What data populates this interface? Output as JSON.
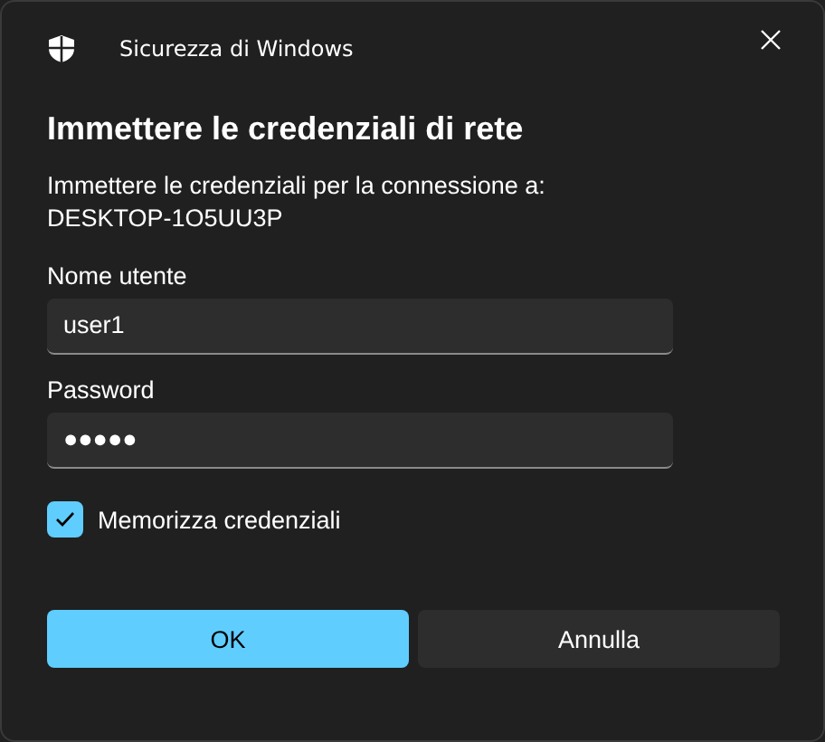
{
  "window": {
    "title": "Sicurezza di Windows"
  },
  "heading": "Immettere le credenziali di rete",
  "description": [
    "Immettere le credenziali per la connessione a:",
    "DESKTOP-1O5UU3P"
  ],
  "fields": [
    {
      "label": "Nome utente",
      "value": "user1"
    },
    {
      "label": "Password",
      "value": "●●●●●"
    }
  ],
  "remember": {
    "label": "Memorizza credenziali",
    "checked": true
  },
  "buttons": [
    {
      "label": "OK",
      "kind": "primary"
    },
    {
      "label": "Annulla",
      "kind": "secondary"
    }
  ]
}
